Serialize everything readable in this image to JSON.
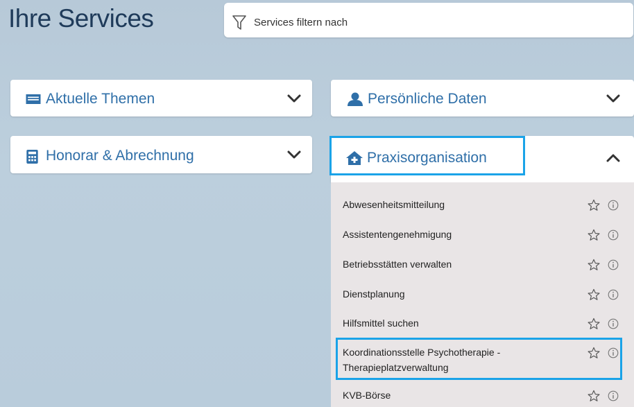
{
  "header": {
    "title": "Ihre Services",
    "filter_placeholder": "Services filtern nach"
  },
  "cards": {
    "aktuelle_themen": "Aktuelle Themen",
    "persoenliche_daten": "Persönliche Daten",
    "honorar": "Honorar & Abrechnung",
    "praxisorganisation": "Praxisorganisation"
  },
  "praxis_items": [
    {
      "label": "Abwesenheitsmitteilung"
    },
    {
      "label": "Assistentengenehmigung"
    },
    {
      "label": "Betriebsstätten verwalten"
    },
    {
      "label": "Dienstplanung"
    },
    {
      "label": "Hilfsmittel suchen"
    },
    {
      "label_line1": "Koordinationsstelle Psychotherapie -",
      "label_line2": "Therapieplatzverwaltung"
    },
    {
      "label": "KVB-Börse"
    }
  ],
  "icons": {
    "filter": "funnel-icon",
    "aktuelle_themen": "newspaper-icon",
    "persoenliche_daten": "person-icon",
    "honorar": "calculator-icon",
    "praxisorganisation": "house-plus-icon",
    "expand": "chevron-down-icon",
    "collapse": "chevron-up-icon",
    "favorite": "star-outline-icon",
    "info": "info-circle-icon"
  },
  "colors": {
    "accent": "#2f6fa8",
    "highlight": "#1aa3e8",
    "title": "#1f3b5a"
  }
}
